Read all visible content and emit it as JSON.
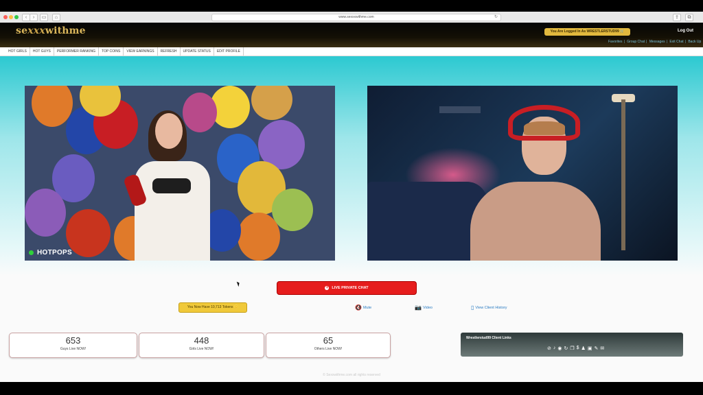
{
  "browser": {
    "url": "www.sexxxwithme.com",
    "reload_icon": "reload-icon"
  },
  "header": {
    "logo_pre": "se",
    "logo_xxx": "xxx",
    "logo_post": "withme",
    "logged_in": "You Are Logged In As WRESTLERSTUD99",
    "logout": "Log Out",
    "links": [
      "Favorites",
      "|",
      "Group Chat",
      "|",
      "Messages",
      "|",
      "Exit Chat",
      "|",
      "Back Up"
    ]
  },
  "nav": [
    "HOT GIRLS",
    "HOT GUYS",
    "PERFORMER RANKING",
    "TOP COINS",
    "VIEW EARNINGS",
    "REFRESH",
    "UPDATE STATUS",
    "EDIT PROFILE"
  ],
  "video_left": {
    "performer_name": "HOTPOPS",
    "status_color": "#2fd13a"
  },
  "controls": {
    "private_chat": "LIVE PRIVATE CHAT",
    "tokens": "You Now Have 10,713 Tokens",
    "mute": "Mute",
    "video": "Video",
    "history": "View Client History"
  },
  "stats": [
    {
      "value": "653",
      "label": "Guys Live NOW!"
    },
    {
      "value": "448",
      "label": "Girls Live NOW!"
    },
    {
      "value": "65",
      "label": "Others Live NOW!"
    }
  ],
  "client_links": {
    "title": "Wrestlerstud99 Client Links"
  },
  "footer": "© Sexxwithme.com all rights reserved",
  "colors": {
    "accent_red": "#e61d1d",
    "gold": "#e2b93e",
    "link_blue": "#2a7bc2",
    "teal": "#2cc9d1"
  }
}
